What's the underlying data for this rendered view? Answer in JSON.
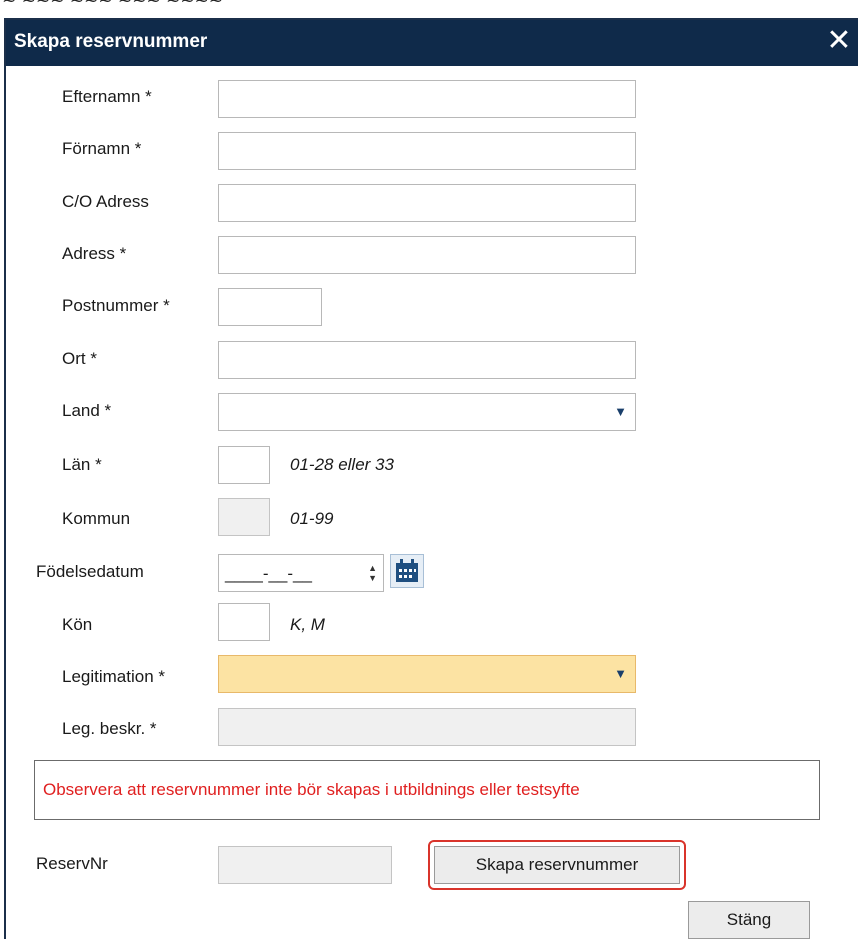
{
  "page_top": {
    "cut_text": "~ ~~~ ~~~ ~~~ ~~~~"
  },
  "dialog": {
    "title": "Skapa reservnummer",
    "close_glyph": "✕"
  },
  "form": {
    "efternamn": {
      "label": "Efternamn *",
      "value": ""
    },
    "fornamn": {
      "label": "Förnamn *",
      "value": ""
    },
    "co_adress": {
      "label": "C/O Adress",
      "value": ""
    },
    "adress": {
      "label": "Adress *",
      "value": ""
    },
    "postnummer": {
      "label": "Postnummer *",
      "value": ""
    },
    "ort": {
      "label": "Ort *",
      "value": ""
    },
    "land": {
      "label": "Land *",
      "value": ""
    },
    "lan": {
      "label": "Län *",
      "value": "",
      "hint": "01-28 eller 33"
    },
    "kommun": {
      "label": "Kommun",
      "value": "",
      "hint": "01-99"
    },
    "fodelsedatum": {
      "label": "Födelsedatum",
      "mask": "____-__-__"
    },
    "kon": {
      "label": "Kön",
      "value": "",
      "hint": "K, M"
    },
    "legitimation": {
      "label": "Legitimation *",
      "value": ""
    },
    "leg_beskr": {
      "label": "Leg. beskr. *",
      "value": ""
    }
  },
  "notice": {
    "text": "Observera att reservnummer inte bör skapas i utbildnings eller testsyfte"
  },
  "reservnr": {
    "label": "ReservNr",
    "value": "",
    "create_button": "Skapa reservnummer"
  },
  "footer": {
    "close_button_prefix": "Stän",
    "close_button_mnemonic": "g"
  },
  "icons": {
    "dropdown": "▼",
    "spinner_up": "▲",
    "spinner_down": "▼"
  },
  "colors": {
    "titlebar": "#0f2a4a",
    "required_highlight": "#fce3a3",
    "notice_text": "#e02020",
    "button_outline": "#d9342b"
  }
}
